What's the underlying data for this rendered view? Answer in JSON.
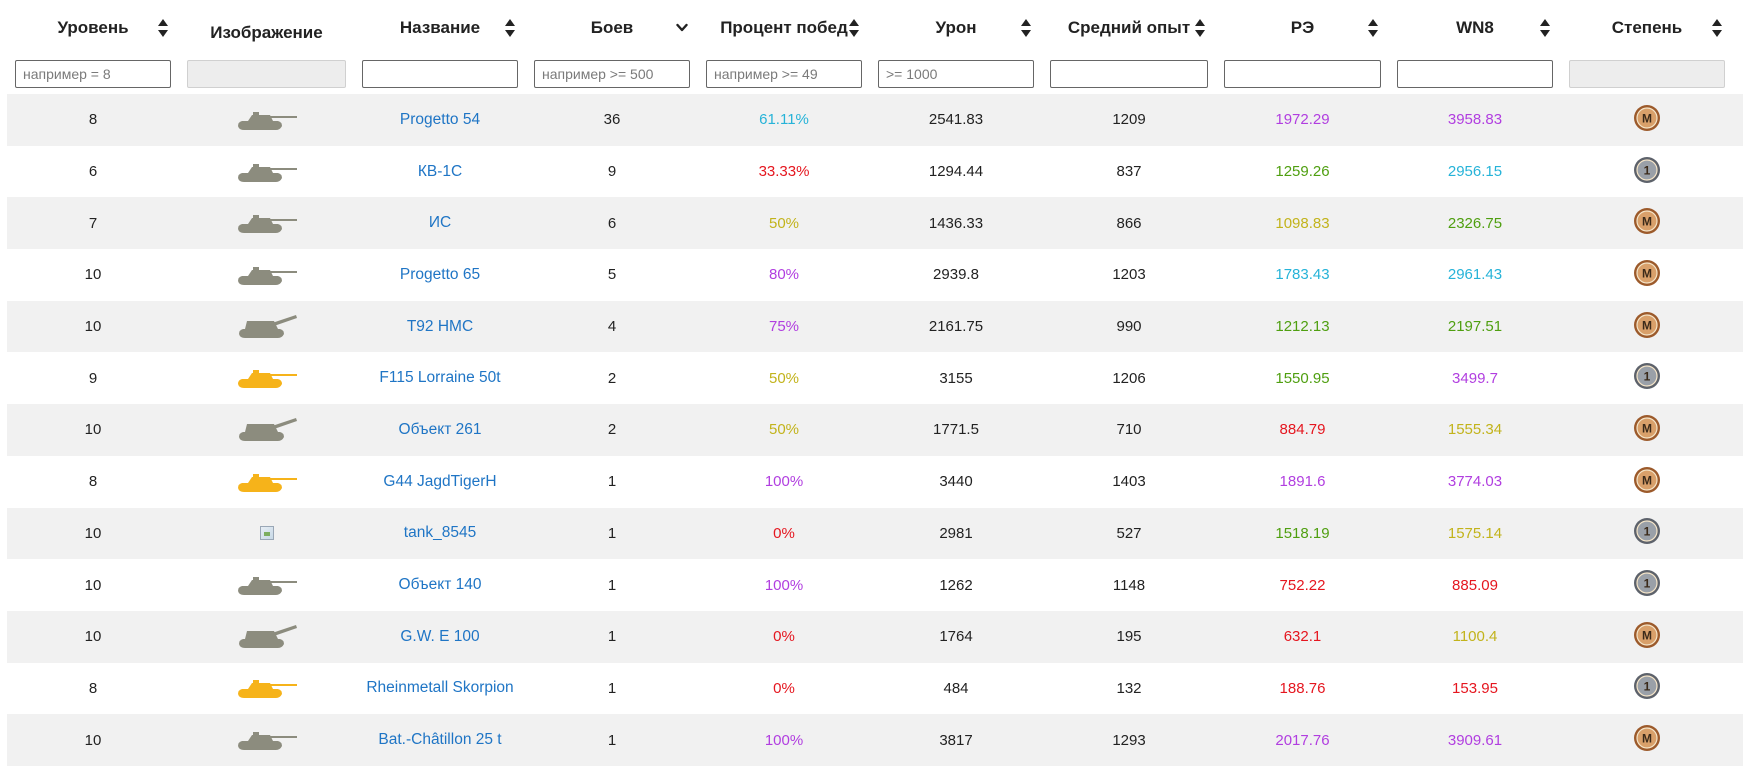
{
  "colors": {
    "purple": "#b13ee0",
    "cyan": "#26b3d8",
    "green": "#4f9f10",
    "yellow": "#c2b31b",
    "red": "#e5161f",
    "link": "#1f75c5",
    "tank_gray": "#8c8c7e",
    "tank_gold": "#f6b31a",
    "medal_master": "#a86a3a",
    "medal_first": "#6a6f78"
  },
  "header": {
    "columns": [
      {
        "label": "Уровень",
        "sortable": true,
        "sort_state": "none"
      },
      {
        "label": "Изображение",
        "sortable": false
      },
      {
        "label": "Название",
        "sortable": true,
        "sort_state": "none"
      },
      {
        "label": "Боев",
        "sortable": true,
        "sort_state": "desc"
      },
      {
        "label": "Процент побед",
        "sortable": true,
        "sort_state": "none"
      },
      {
        "label": "Урон",
        "sortable": true,
        "sort_state": "none"
      },
      {
        "label": "Средний опыт",
        "sortable": true,
        "sort_state": "none"
      },
      {
        "label": "РЭ",
        "sortable": true,
        "sort_state": "none"
      },
      {
        "label": "WN8",
        "sortable": true,
        "sort_state": "none"
      },
      {
        "label": "Степень",
        "sortable": true,
        "sort_state": "none"
      }
    ]
  },
  "filters": {
    "level": {
      "placeholder": "например = 8",
      "value": ""
    },
    "image": {
      "placeholder": "",
      "disabled": true
    },
    "name": {
      "placeholder": "",
      "value": ""
    },
    "battles": {
      "placeholder": "например >= 500",
      "value": ""
    },
    "winrate": {
      "placeholder": "например >= 49",
      "value": ""
    },
    "damage": {
      "placeholder": ">= 1000",
      "value": ""
    },
    "avg_exp": {
      "placeholder": "",
      "value": ""
    },
    "re": {
      "placeholder": "",
      "value": ""
    },
    "wn8": {
      "placeholder": "",
      "value": ""
    },
    "mastery": {
      "placeholder": "",
      "disabled": true
    }
  },
  "rows": [
    {
      "level": "8",
      "image_icon": "tank-gray-icon",
      "image_color": "gray",
      "name": "Progetto 54",
      "battles": "36",
      "winrate": "61.11%",
      "winrate_color": "cyan",
      "damage": "2541.83",
      "avg_exp": "1209",
      "re": "1972.29",
      "re_color": "purple",
      "wn8": "3958.83",
      "wn8_color": "purple",
      "mastery": "master"
    },
    {
      "level": "6",
      "image_icon": "tank-gray-icon",
      "image_color": "gray",
      "name": "КВ-1С",
      "battles": "9",
      "winrate": "33.33%",
      "winrate_color": "red",
      "damage": "1294.44",
      "avg_exp": "837",
      "re": "1259.26",
      "re_color": "green",
      "wn8": "2956.15",
      "wn8_color": "cyan",
      "mastery": "first"
    },
    {
      "level": "7",
      "image_icon": "tank-gray-icon",
      "image_color": "gray",
      "name": "ИС",
      "battles": "6",
      "winrate": "50%",
      "winrate_color": "yellow",
      "damage": "1436.33",
      "avg_exp": "866",
      "re": "1098.83",
      "re_color": "yellow",
      "wn8": "2326.75",
      "wn8_color": "green",
      "mastery": "master"
    },
    {
      "level": "10",
      "image_icon": "tank-gray-icon",
      "image_color": "gray",
      "name": "Progetto 65",
      "battles": "5",
      "winrate": "80%",
      "winrate_color": "purple",
      "damage": "2939.8",
      "avg_exp": "1203",
      "re": "1783.43",
      "re_color": "cyan",
      "wn8": "2961.43",
      "wn8_color": "cyan",
      "mastery": "master"
    },
    {
      "level": "10",
      "image_icon": "spg-gray-icon",
      "image_color": "gray",
      "name": "T92 HMC",
      "battles": "4",
      "winrate": "75%",
      "winrate_color": "purple",
      "damage": "2161.75",
      "avg_exp": "990",
      "re": "1212.13",
      "re_color": "green",
      "wn8": "2197.51",
      "wn8_color": "green",
      "mastery": "master"
    },
    {
      "level": "9",
      "image_icon": "tank-gold-icon",
      "image_color": "gold",
      "name": "F115 Lorraine 50t",
      "battles": "2",
      "winrate": "50%",
      "winrate_color": "yellow",
      "damage": "3155",
      "avg_exp": "1206",
      "re": "1550.95",
      "re_color": "green",
      "wn8": "3499.7",
      "wn8_color": "purple",
      "mastery": "first"
    },
    {
      "level": "10",
      "image_icon": "spg-gray-icon",
      "image_color": "gray",
      "name": "Объект 261",
      "battles": "2",
      "winrate": "50%",
      "winrate_color": "yellow",
      "damage": "1771.5",
      "avg_exp": "710",
      "re": "884.79",
      "re_color": "red",
      "wn8": "1555.34",
      "wn8_color": "yellow",
      "mastery": "master"
    },
    {
      "level": "8",
      "image_icon": "tank-gold-icon",
      "image_color": "gold",
      "name": "G44 JagdTigerH",
      "battles": "1",
      "winrate": "100%",
      "winrate_color": "purple",
      "damage": "3440",
      "avg_exp": "1403",
      "re": "1891.6",
      "re_color": "purple",
      "wn8": "3774.03",
      "wn8_color": "purple",
      "mastery": "master"
    },
    {
      "level": "10",
      "image_icon": "broken-image-icon",
      "image_color": "none",
      "name": "tank_8545",
      "battles": "1",
      "winrate": "0%",
      "winrate_color": "red",
      "damage": "2981",
      "avg_exp": "527",
      "re": "1518.19",
      "re_color": "green",
      "wn8": "1575.14",
      "wn8_color": "yellow",
      "mastery": "first"
    },
    {
      "level": "10",
      "image_icon": "tank-gray-icon",
      "image_color": "gray",
      "name": "Объект 140",
      "battles": "1",
      "winrate": "100%",
      "winrate_color": "purple",
      "damage": "1262",
      "avg_exp": "1148",
      "re": "752.22",
      "re_color": "red",
      "wn8": "885.09",
      "wn8_color": "red",
      "mastery": "first"
    },
    {
      "level": "10",
      "image_icon": "spg-gray-icon",
      "image_color": "gray",
      "name": "G.W. E 100",
      "battles": "1",
      "winrate": "0%",
      "winrate_color": "red",
      "damage": "1764",
      "avg_exp": "195",
      "re": "632.1",
      "re_color": "red",
      "wn8": "1100.4",
      "wn8_color": "yellow",
      "mastery": "master"
    },
    {
      "level": "8",
      "image_icon": "tank-gold-icon",
      "image_color": "gold",
      "name": "Rheinmetall Skorpion",
      "battles": "1",
      "winrate": "0%",
      "winrate_color": "red",
      "damage": "484",
      "avg_exp": "132",
      "re": "188.76",
      "re_color": "red",
      "wn8": "153.95",
      "wn8_color": "red",
      "mastery": "first"
    },
    {
      "level": "10",
      "image_icon": "tank-gray-icon",
      "image_color": "gray",
      "name": "Bat.-Châtillon 25 t",
      "battles": "1",
      "winrate": "100%",
      "winrate_color": "purple",
      "damage": "3817",
      "avg_exp": "1293",
      "re": "2017.76",
      "re_color": "purple",
      "wn8": "3909.61",
      "wn8_color": "purple",
      "mastery": "master"
    }
  ],
  "mastery_labels": {
    "master": "M",
    "first": "1"
  }
}
